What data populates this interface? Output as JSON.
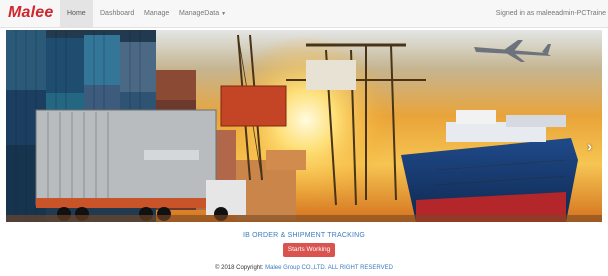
{
  "brand": {
    "logo_text": "Malee",
    "color": "#d0262c"
  },
  "nav": {
    "items": [
      {
        "label": "Home",
        "active": true
      },
      {
        "label": "Dashboard",
        "active": false
      },
      {
        "label": "Manage",
        "active": false
      },
      {
        "label": "ManageData",
        "active": false
      }
    ],
    "signed_in": "Signed in as maleeadmin-PCTraine"
  },
  "hero": {
    "arrow": "›",
    "image": "port-shipping-sunset"
  },
  "main": {
    "tracking_title": "IB ORDER & SHIPMENT TRACKING",
    "start_button": "Starts Working"
  },
  "footer": {
    "copyright": "© 2018 Copyright:",
    "company": "Malee Group CO.,LTD. ALL RIGHT RESERVED"
  },
  "colors": {
    "accent": "#d9534f",
    "link": "#3b7bbf"
  }
}
